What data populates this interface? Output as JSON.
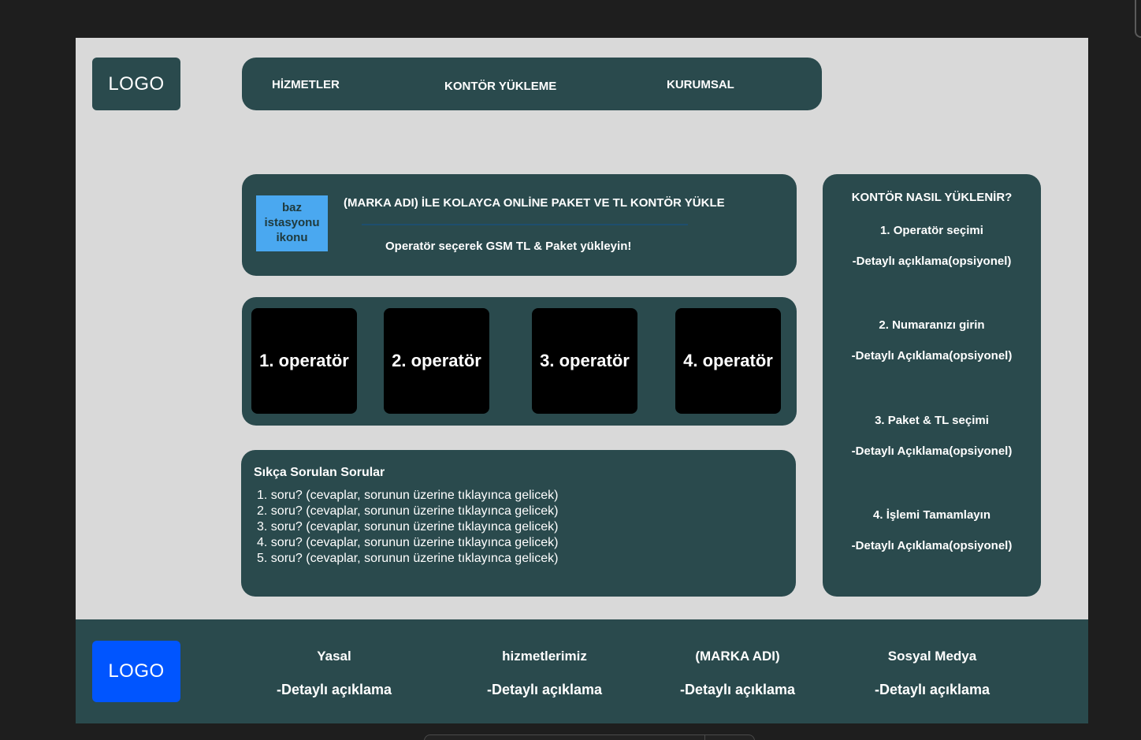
{
  "header": {
    "logo": "LOGO",
    "nav": [
      "HİZMETLER",
      "KONTÖR YÜKLEME",
      "KURUMSAL"
    ]
  },
  "hero": {
    "icon_label": "baz istasyonu ikonu",
    "title": "(MARKA ADI) İLE KOLAYCA ONLİNE PAKET VE TL KONTÖR YÜKLE",
    "subtitle": "Operatör seçerek GSM TL & Paket yükleyin!"
  },
  "operators": [
    "1. operatör",
    "2. operatör",
    "3. operatör",
    "4. operatör"
  ],
  "faq": {
    "title": "Sıkça Sorulan Sorular",
    "items": [
      "1. soru? (cevaplar, sorunun üzerine tıklayınca gelicek)",
      "2. soru? (cevaplar, sorunun üzerine tıklayınca gelicek)",
      "3. soru? (cevaplar, sorunun üzerine tıklayınca gelicek)",
      "4. soru? (cevaplar, sorunun üzerine tıklayınca gelicek)",
      "5. soru? (cevaplar, sorunun üzerine tıklayınca gelicek)"
    ]
  },
  "howto": {
    "title": "KONTÖR NASIL YÜKLENİR?",
    "steps": [
      {
        "label": "1. Operatör seçimi",
        "detail": "-Detaylı açıklama(opsiyonel)"
      },
      {
        "label": "2. Numaranızı girin",
        "detail": "-Detaylı Açıklama(opsiyonel)"
      },
      {
        "label": "3. Paket & TL seçimi",
        "detail": "-Detaylı Açıklama(opsiyonel)"
      },
      {
        "label": "4. İşlemi Tamamlayın",
        "detail": "-Detaylı Açıklama(opsiyonel)"
      }
    ]
  },
  "footer": {
    "logo": "LOGO",
    "columns": [
      {
        "title": "Yasal",
        "detail": "-Detaylı açıklama"
      },
      {
        "title": "hizmetlerimiz",
        "detail": "-Detaylı açıklama"
      },
      {
        "title": "(MARKA ADI)",
        "detail": "-Detaylı açıklama"
      },
      {
        "title": "Sosyal Medya",
        "detail": "-Detaylı açıklama"
      }
    ]
  },
  "colors": {
    "page_background": "#d9d9d9",
    "panel": "#2a4a4d",
    "icon_box": "#4aa8f0",
    "footer_logo": "#0055ff",
    "operator_tile": "#000000"
  }
}
